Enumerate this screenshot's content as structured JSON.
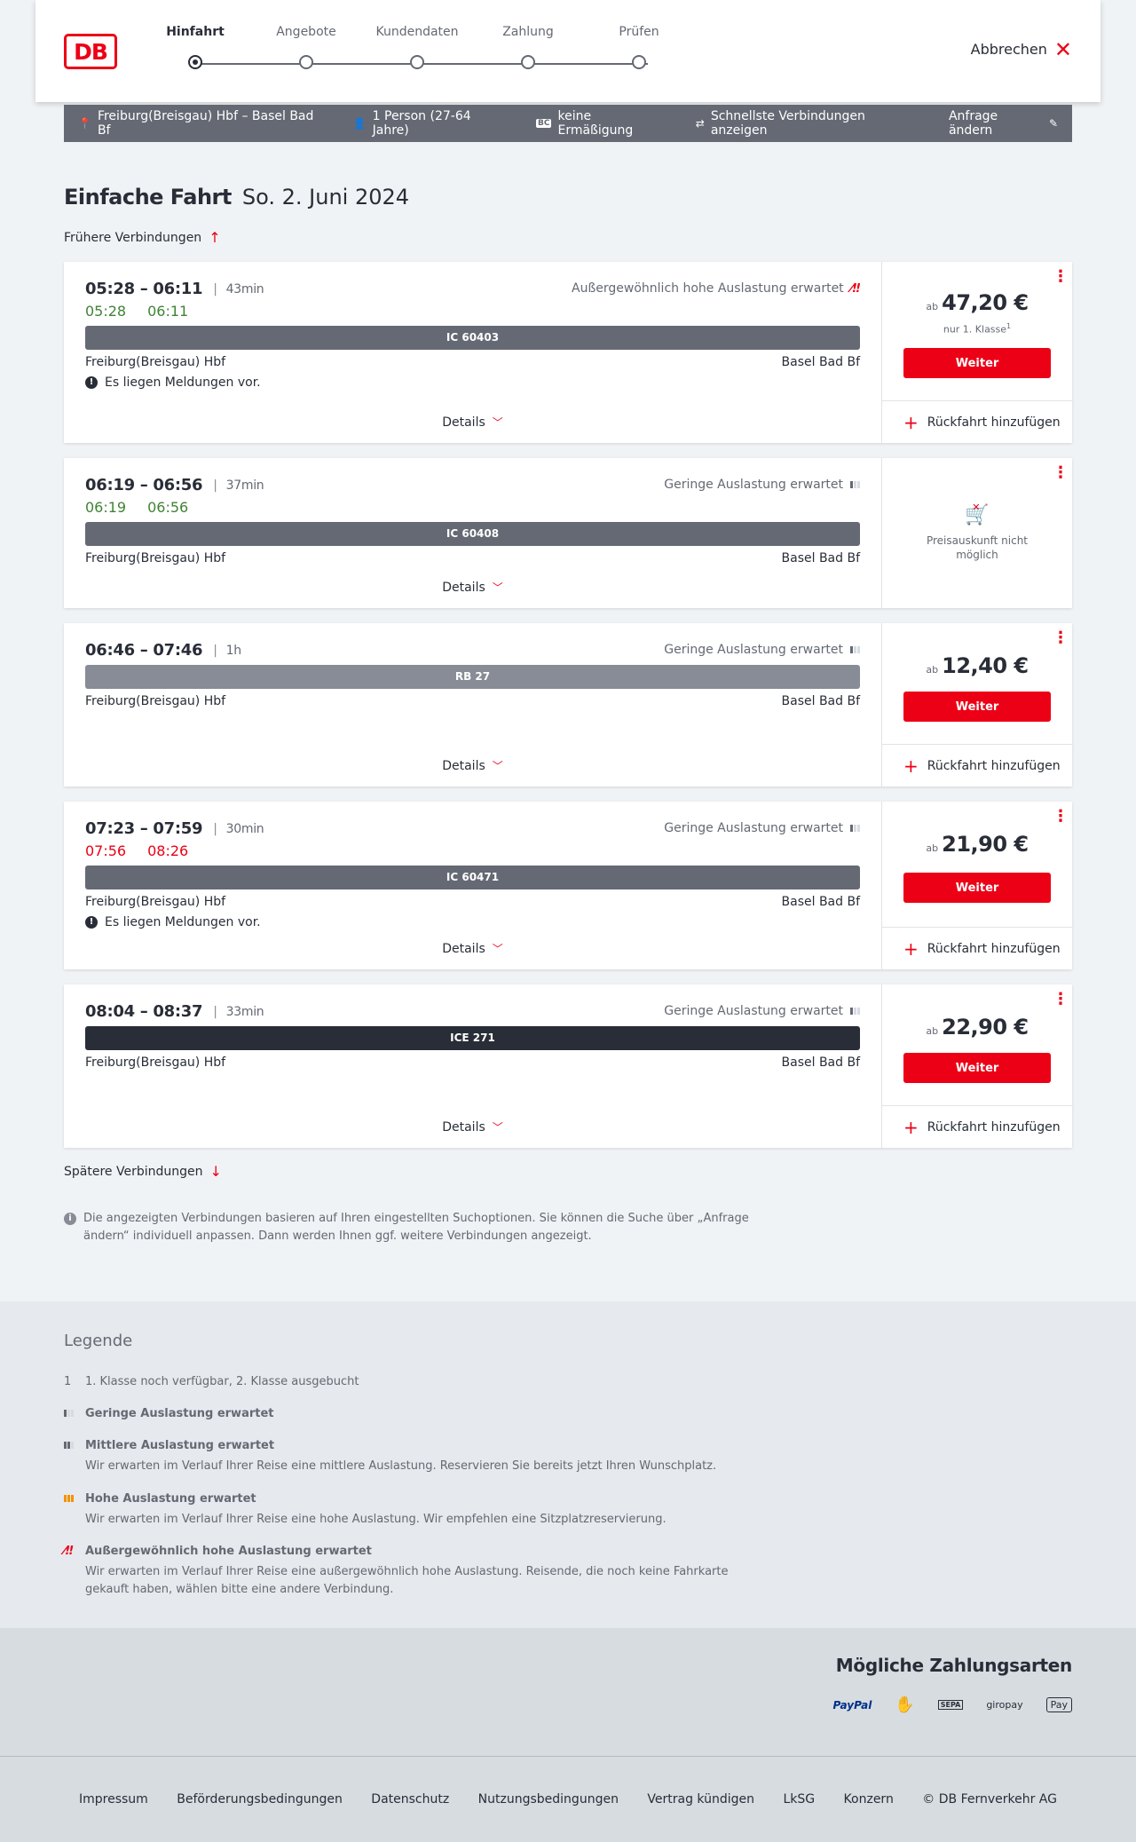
{
  "header": {
    "logo": "DB",
    "steps": [
      "Hinfahrt",
      "Angebote",
      "Kundendaten",
      "Zahlung",
      "Prüfen"
    ],
    "active_step": 0,
    "cancel": "Abbrechen"
  },
  "search": {
    "route": "Freiburg(Breisgau) Hbf – Basel Bad Bf",
    "persons": "1 Person (27-64 Jahre)",
    "bahncard_badge": "BC",
    "discount": "keine Ermäßigung",
    "fastest": "Schnellste Verbindungen anzeigen",
    "edit": "Anfrage ändern"
  },
  "page": {
    "title": "Einfache Fahrt",
    "date": "So. 2. Juni 2024",
    "earlier": "Frühere Verbindungen",
    "later": "Spätere Verbindungen",
    "info": "Die angezeigten Verbindungen basieren auf Ihren eingestellten Suchoptionen. Sie können die Suche über „Anfrage ändern“ individuell anpassen. Dann werden Ihnen ggf. weitere Verbindungen angezeigt."
  },
  "labels": {
    "details": "Details",
    "weiter": "Weiter",
    "return": "Rückfahrt hinzufügen",
    "ab": "ab",
    "no_price": "Preisauskunft nicht möglich",
    "message": "Es liegen Meldungen vor."
  },
  "connections": [
    {
      "times": "05:28 – 06:11",
      "duration": "43min",
      "rt_dep": "05:28",
      "rt_arr": "06:11",
      "occupancy": "Außergewöhnlich hohe Auslastung erwartet",
      "train": "IC 60403",
      "from": "Freiburg(Breisgau) Hbf",
      "to": "Basel Bad Bf",
      "price": "47,20 €",
      "price_note": "nur 1. Klasse",
      "price_note_sup": "1"
    },
    {
      "times": "06:19 – 06:56",
      "duration": "37min",
      "rt_dep": "06:19",
      "rt_arr": "06:56",
      "occupancy": "Geringe Auslastung erwartet",
      "train": "IC 60408",
      "from": "Freiburg(Breisgau) Hbf",
      "to": "Basel Bad Bf"
    },
    {
      "times": "06:46 – 07:46",
      "duration": "1h",
      "occupancy": "Geringe Auslastung erwartet",
      "train": "RB 27",
      "from": "Freiburg(Breisgau) Hbf",
      "to": "Basel Bad Bf",
      "price": "12,40 €"
    },
    {
      "times": "07:23 – 07:59",
      "duration": "30min",
      "rt_dep": "07:56",
      "rt_arr": "08:26",
      "occupancy": "Geringe Auslastung erwartet",
      "train": "IC 60471",
      "from": "Freiburg(Breisgau) Hbf",
      "to": "Basel Bad Bf",
      "price": "21,90 €"
    },
    {
      "times": "08:04 – 08:37",
      "duration": "33min",
      "occupancy": "Geringe Auslastung erwartet",
      "train": "ICE 271",
      "from": "Freiburg(Breisgau) Hbf",
      "to": "Basel Bad Bf",
      "price": "22,90 €"
    }
  ],
  "legend": {
    "title": "Legende",
    "footnote_key": "1",
    "footnote": "1. Klasse noch verfügbar, 2. Klasse ausgebucht",
    "low": "Geringe Auslastung erwartet",
    "mid": "Mittlere Auslastung erwartet",
    "mid_desc": "Wir erwarten im Verlauf Ihrer Reise eine mittlere Auslastung. Reservieren Sie bereits jetzt Ihren Wunschplatz.",
    "high": "Hohe Auslastung erwartet",
    "high_desc": "Wir erwarten im Verlauf Ihrer Reise eine hohe Auslastung. Wir empfehlen eine Sitzplatzreservierung.",
    "extreme": "Außergewöhnlich hohe Auslastung erwartet",
    "extreme_desc": "Wir erwarten im Verlauf Ihrer Reise eine außergewöhnlich hohe Auslastung. Reisende, die noch keine Fahrkarte gekauft haben, wählen bitte eine andere Verbindung."
  },
  "payment": {
    "title": "Mögliche Zahlungsarten",
    "paypal": "PayPal",
    "sepa": "SEPA",
    "giropay": "giropay",
    "applepay": "Pay"
  },
  "footer": [
    "Impressum",
    "Beförderungsbedingungen",
    "Datenschutz",
    "Nutzungsbedingungen",
    "Vertrag kündigen",
    "LkSG",
    "Konzern",
    "© DB Fernverkehr AG"
  ],
  "colors": {
    "accent": "#ec0016",
    "delay_ok": "#408335",
    "bar_ic": "#646973",
    "bar_rb": "#878c96",
    "bar_ice": "#282d37"
  }
}
